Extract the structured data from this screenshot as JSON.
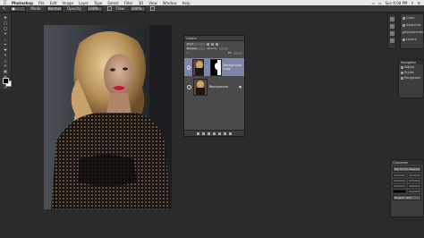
{
  "menubar": {
    "app_name": "Photoshop",
    "items": [
      "File",
      "Edit",
      "Image",
      "Layer",
      "Type",
      "Select",
      "Filter",
      "3D",
      "View",
      "Window",
      "Help"
    ],
    "clock": "Sun 6:08 PM"
  },
  "options_bar": {
    "mode_label": "Mode:",
    "mode_value": "Normal",
    "opacity_label": "Opacity:",
    "opacity_value": "100%",
    "flow_label": "Flow:",
    "flow_value": "100%"
  },
  "layers_panel": {
    "title": "Layers",
    "kind_value": "Kind",
    "blend_value": "Normal",
    "opacity_label": "Opacity",
    "fill_label": "Fill",
    "layers": [
      {
        "name": "Background copy",
        "selected": true,
        "has_mask": true
      },
      {
        "name": "Background",
        "selected": false,
        "has_mask": false
      }
    ]
  },
  "dock": {
    "items": [
      "Color",
      "Swatches",
      "Adjustments",
      "Layers"
    ]
  },
  "adjustments_panel": {
    "title": "Navigator",
    "rows": [
      "Adjust",
      "Styles",
      "Paragraph"
    ]
  },
  "character_panel": {
    "title": "Character",
    "font_value": "Myriad Pro Regular",
    "language": "English: USA"
  },
  "colors": {
    "accent_selected_layer": "#7d86a6",
    "lip_color": "#c2163a"
  }
}
